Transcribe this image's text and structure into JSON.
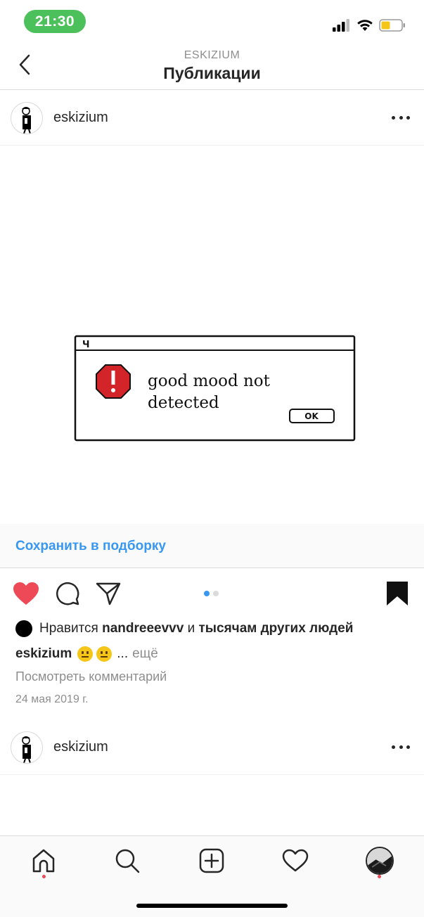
{
  "status_bar": {
    "time": "21:30",
    "icons": [
      "signal-icon",
      "wifi-icon",
      "battery-low-power-icon"
    ],
    "time_pill_color": "#4cc05a",
    "battery_color": "#f5c518"
  },
  "nav": {
    "subtitle": "ESKIZIUM",
    "title": "Публикации"
  },
  "post": {
    "username": "eskizium",
    "image": {
      "dialog_title": "Ч",
      "message_line1": "good mood not",
      "message_line2": "detected",
      "ok_button": "OK",
      "icon": "error-stop-sign-icon"
    },
    "save_to_collection": "Сохранить в подборку",
    "carousel": {
      "total": 2,
      "active": 1
    },
    "likes": {
      "prefix": "Нравится",
      "user": "nandreeevvv",
      "conjunction": "и",
      "others": "тысячам других людей"
    },
    "caption": {
      "username": "eskizium",
      "emojis": [
        "neutral-face-emoji",
        "neutral-face-emoji"
      ],
      "ellipsis": "...",
      "more": "ещё"
    },
    "view_comments": "Посмотреть комментарий",
    "date": "24 мая 2019 г."
  },
  "next_post": {
    "username": "eskizium"
  },
  "tab_bar": {
    "items": [
      "home-icon",
      "search-icon",
      "add-post-icon",
      "activity-heart-icon",
      "profile-avatar"
    ],
    "active": "home-icon"
  },
  "colors": {
    "like_red": "#ed4956",
    "link_blue": "#3897f0",
    "text": "#262626",
    "muted": "#8e8e8e"
  }
}
